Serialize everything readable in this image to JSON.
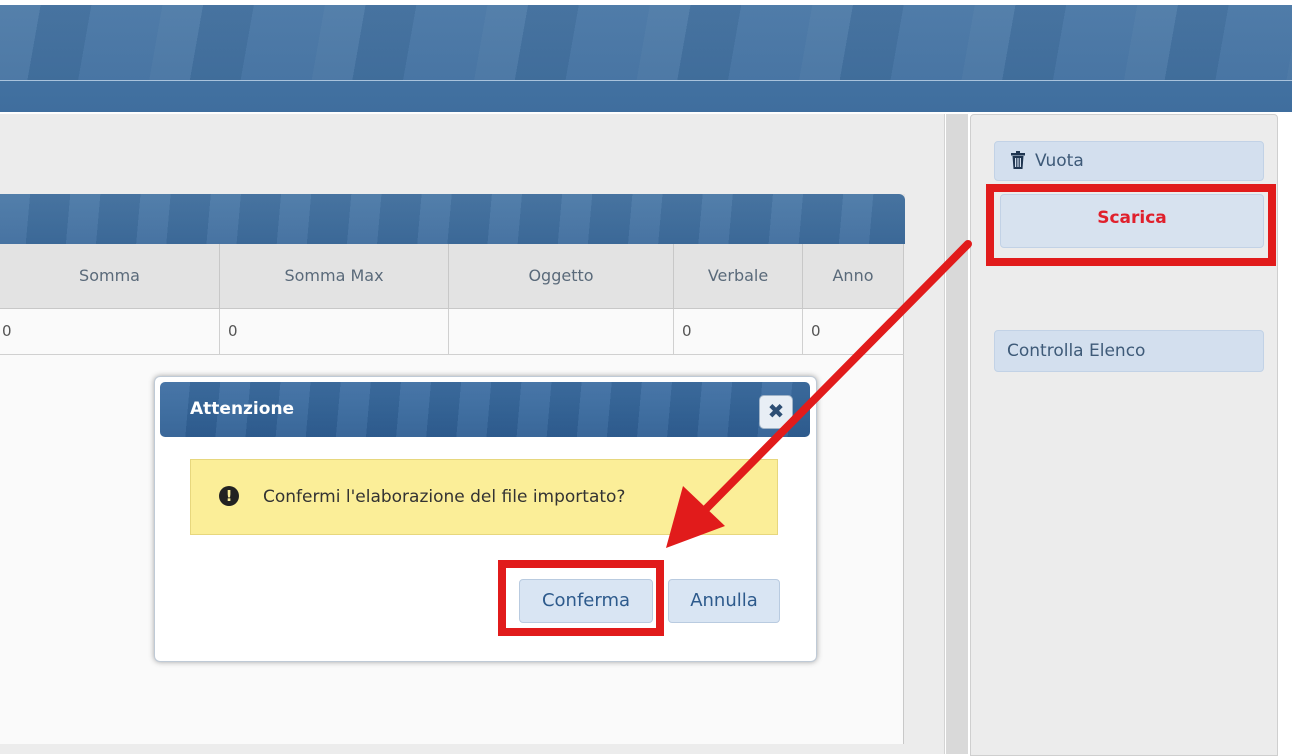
{
  "grid": {
    "columns": [
      "Somma",
      "Somma Max",
      "Oggetto",
      "Verbale",
      "Anno"
    ],
    "rows": [
      [
        "0",
        "",
        "0",
        "",
        "0",
        "0"
      ]
    ]
  },
  "sidebar": {
    "vuota_label": "Vuota",
    "scarica_label": "Scarica",
    "controlla_label": "Controlla Elenco"
  },
  "dialog": {
    "title": "Attenzione",
    "close_symbol": "✖",
    "message": "Confermi l'elaborazione del file importato?",
    "confirm_label": "Conferma",
    "cancel_label": "Annulla"
  },
  "colors": {
    "header_blue": "#4a78a6",
    "highlight_red": "#e11b1b",
    "warning_yellow": "#fbee98",
    "button_blue": "#d3dfee"
  },
  "icons": {
    "vuota": "trash-icon",
    "message": "exclamation-circle-icon",
    "close": "close-icon"
  }
}
